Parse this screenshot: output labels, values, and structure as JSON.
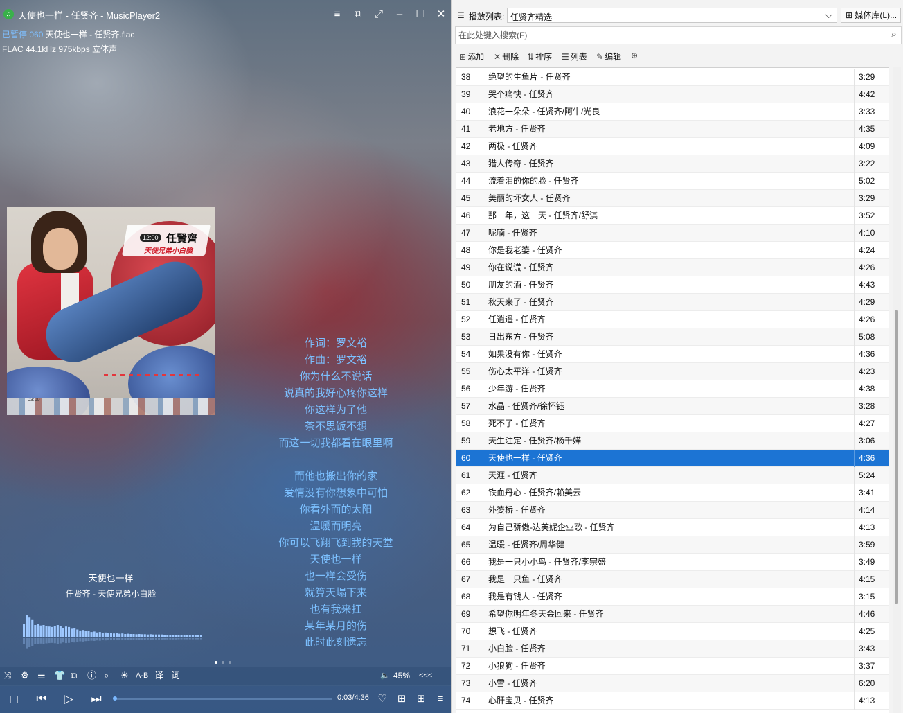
{
  "window": {
    "title": "天使也一样 - 任贤齐 - MusicPlayer2"
  },
  "status": {
    "state": "已暂停",
    "track_no": "060",
    "file": "天使也一样 - 任贤齐.flac",
    "format": "FLAC 44.1kHz 975kbps 立体声"
  },
  "album_art": {
    "clock_text": "12:00",
    "artist_logo": "任賢齊",
    "album_logo": "天使兄弟小白臉",
    "strip_time": "03:00"
  },
  "lyrics": {
    "lines": [
      "作词：罗文裕",
      "作曲：罗文裕",
      "你为什么不说话",
      "说真的我好心疼你这样",
      "你这样为了他",
      "茶不思饭不想",
      "而这一切我都看在眼里啊",
      "",
      "而他也搬出你的家",
      "爱情没有你想象中可怕",
      "你看外面的太阳",
      "温暖而明亮",
      "你可以飞翔飞到我的天堂",
      "天使也一样",
      "也一样会受伤",
      "就算天塌下来",
      "也有我来扛",
      "某年某月的伤",
      "此时此刻遗忘"
    ]
  },
  "now_playing": {
    "title": "天使也一样",
    "artist_album": "任贤齐 - 天使兄弟小白脸"
  },
  "controls": {
    "ab_label": "A-B",
    "translate_label": "译",
    "lyric_label": "词",
    "volume": "45%",
    "volume_value": 45,
    "collapse_label": "<<<",
    "time": "0:03/4:36",
    "progress_fraction": 0.011
  },
  "spectrum": {
    "bars": [
      0.55,
      0.9,
      0.8,
      0.7,
      0.5,
      0.55,
      0.48,
      0.5,
      0.46,
      0.44,
      0.42,
      0.45,
      0.5,
      0.46,
      0.38,
      0.44,
      0.42,
      0.35,
      0.38,
      0.32,
      0.28,
      0.3,
      0.26,
      0.25,
      0.22,
      0.24,
      0.2,
      0.22,
      0.18,
      0.2,
      0.17,
      0.18,
      0.16,
      0.17,
      0.15,
      0.16,
      0.14,
      0.15,
      0.14,
      0.14,
      0.13,
      0.14,
      0.13,
      0.13,
      0.12,
      0.13,
      0.12,
      0.12,
      0.12,
      0.12,
      0.11,
      0.11,
      0.11,
      0.11,
      0.11,
      0.1,
      0.1,
      0.1,
      0.1,
      0.1,
      0.1,
      0.1,
      0.1,
      0.1
    ],
    "color": "#9ec8ff"
  },
  "playlist": {
    "label": "播放列表:",
    "selected_playlist": "任贤齐精选",
    "media_lib_button": "媒体库(L)...",
    "search_placeholder": "在此处键入搜索(F)",
    "toolbar": {
      "add": "添加",
      "delete": "删除",
      "sort": "排序",
      "list": "列表",
      "edit": "编辑"
    },
    "selected_index": 60,
    "accent": "#1c74d4",
    "rows": [
      {
        "n": "38",
        "t": "绝望的生鱼片 - 任贤齐",
        "d": "3:29"
      },
      {
        "n": "39",
        "t": "哭个痛快 - 任贤齐",
        "d": "4:42"
      },
      {
        "n": "40",
        "t": "浪花一朵朵 - 任贤齐/阿牛/光良",
        "d": "3:33"
      },
      {
        "n": "41",
        "t": "老地方 - 任贤齐",
        "d": "4:35"
      },
      {
        "n": "42",
        "t": "两极 - 任贤齐",
        "d": "4:09"
      },
      {
        "n": "43",
        "t": "猎人传奇 - 任贤齐",
        "d": "3:22"
      },
      {
        "n": "44",
        "t": "流着泪的你的脸 - 任贤齐",
        "d": "5:02"
      },
      {
        "n": "45",
        "t": "美丽的坏女人 - 任贤齐",
        "d": "3:29"
      },
      {
        "n": "46",
        "t": "那一年，这一天 - 任贤齐/舒淇",
        "d": "3:52"
      },
      {
        "n": "47",
        "t": "呢喃 - 任贤齐",
        "d": "4:10"
      },
      {
        "n": "48",
        "t": "你是我老婆 - 任贤齐",
        "d": "4:24"
      },
      {
        "n": "49",
        "t": "你在说谎 - 任贤齐",
        "d": "4:26"
      },
      {
        "n": "50",
        "t": "朋友的酒 - 任贤齐",
        "d": "4:43"
      },
      {
        "n": "51",
        "t": "秋天来了 - 任贤齐",
        "d": "4:29"
      },
      {
        "n": "52",
        "t": "任逍遥 - 任贤齐",
        "d": "4:26"
      },
      {
        "n": "53",
        "t": "日出东方 - 任贤齐",
        "d": "5:08"
      },
      {
        "n": "54",
        "t": "如果没有你 - 任贤齐",
        "d": "4:36"
      },
      {
        "n": "55",
        "t": "伤心太平洋 - 任贤齐",
        "d": "4:23"
      },
      {
        "n": "56",
        "t": "少年游 - 任贤齐",
        "d": "4:38"
      },
      {
        "n": "57",
        "t": "水晶 - 任贤齐/徐怀钰",
        "d": "3:28"
      },
      {
        "n": "58",
        "t": "死不了 - 任贤齐",
        "d": "4:27"
      },
      {
        "n": "59",
        "t": "天生注定 - 任贤齐/杨千嬅",
        "d": "3:06"
      },
      {
        "n": "60",
        "t": "天使也一样 - 任贤齐",
        "d": "4:36"
      },
      {
        "n": "61",
        "t": "天涯 - 任贤齐",
        "d": "5:24"
      },
      {
        "n": "62",
        "t": "铁血丹心 - 任贤齐/赖美云",
        "d": "3:41"
      },
      {
        "n": "63",
        "t": "外婆桥 - 任贤齐",
        "d": "4:14"
      },
      {
        "n": "64",
        "t": "为自己骄傲-达芙妮企业歌 - 任贤齐",
        "d": "4:13"
      },
      {
        "n": "65",
        "t": "温暖 - 任贤齐/周华健",
        "d": "3:59"
      },
      {
        "n": "66",
        "t": "我是一只小小鸟 - 任贤齐/李宗盛",
        "d": "3:49"
      },
      {
        "n": "67",
        "t": "我是一只鱼 - 任贤齐",
        "d": "4:15"
      },
      {
        "n": "68",
        "t": "我是有钱人 - 任贤齐",
        "d": "3:15"
      },
      {
        "n": "69",
        "t": "希望你明年冬天会回来 - 任贤齐",
        "d": "4:46"
      },
      {
        "n": "70",
        "t": "想飞 - 任贤齐",
        "d": "4:25"
      },
      {
        "n": "71",
        "t": "小白脸 - 任贤齐",
        "d": "3:43"
      },
      {
        "n": "72",
        "t": "小狼狗 - 任贤齐",
        "d": "3:37"
      },
      {
        "n": "73",
        "t": "小雪 - 任贤齐",
        "d": "6:20"
      },
      {
        "n": "74",
        "t": "心肝宝贝 - 任贤齐",
        "d": "4:13"
      }
    ]
  }
}
